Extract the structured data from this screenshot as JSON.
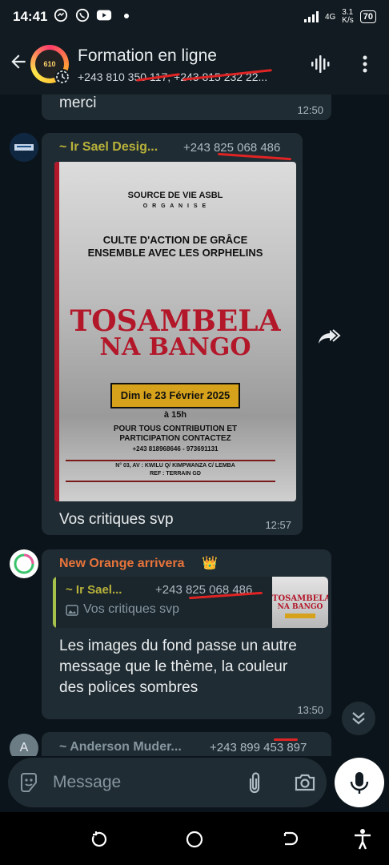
{
  "status": {
    "time": "14:41",
    "network": "4G",
    "speed_top": "3.1",
    "speed_bottom": "K/s",
    "battery": "70"
  },
  "header": {
    "title": "Formation en ligne",
    "subtitle": "+243 810 350 117, +243 815 232 22...",
    "avatar_text": "610"
  },
  "messages": {
    "m1": {
      "text": "merci",
      "time": "12:50"
    },
    "m2": {
      "sender": "~ Ir Sael Desig...",
      "phone": "+243 825 068 486",
      "caption": "Vos critiques svp",
      "time": "12:57",
      "poster": {
        "org": "SOURCE DE VIE ASBL",
        "organise": "O R G A N I S E",
        "event": "CULTE D'ACTION DE GRÂCE ENSEMBLE AVEC LES ORPHELINS",
        "title1": "TOSAMBELA",
        "title2": "NA BANGO",
        "date": "Dim le 23 Février 2025",
        "hour": "à 15h",
        "contact1": "POUR TOUS CONTRIBUTION ET",
        "contact2": "PARTICIPATION CONTACTEZ",
        "contact3": "+243 818968646 - 973691131",
        "address1": "N° 03, AV : KWILU Q/ KIMPWANZA C/ LEMBA",
        "address2": "REF : TERRAIN GD"
      }
    },
    "m3": {
      "sender": "New Orange arrivera",
      "crown": "👑",
      "quote_sender": "~ Ir Sael...",
      "quote_phone": "+243 825 068 486",
      "quote_text": "Vos critiques svp",
      "thumb_title1": "TOSAMBELA",
      "thumb_title2": "NA BANGO",
      "text": "Les images du fond passe un autre message que le thème, la couleur des polices sombres",
      "time": "13:50"
    },
    "m4": {
      "avatar_letter": "A",
      "sender": "~ Anderson Muder...",
      "phone": "+243 899 453 897"
    }
  },
  "input": {
    "placeholder": "Message"
  },
  "colors": {
    "accent_yellow": "#b9b23a",
    "accent_orange": "#e8743b",
    "bg": "#0b141a",
    "bubble": "#202c33"
  }
}
